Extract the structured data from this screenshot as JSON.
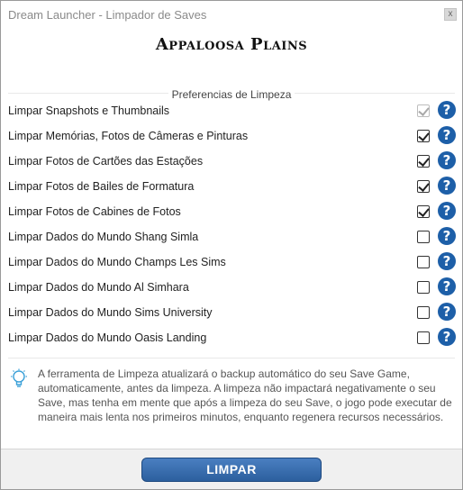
{
  "window": {
    "title": "Dream Launcher - Limpador de Saves",
    "close_glyph": "x"
  },
  "heading": "Appaloosa Plains",
  "section_label": "Preferencias de Limpeza",
  "options": [
    {
      "label": "Limpar Snapshots e Thumbnails",
      "checked": true,
      "disabled": true
    },
    {
      "label": "Limpar Memórias, Fotos de Câmeras e Pinturas",
      "checked": true,
      "disabled": false
    },
    {
      "label": "Limpar Fotos de Cartões das Estações",
      "checked": true,
      "disabled": false
    },
    {
      "label": "Limpar Fotos de Bailes de Formatura",
      "checked": true,
      "disabled": false
    },
    {
      "label": "Limpar Fotos de Cabines de Fotos",
      "checked": true,
      "disabled": false
    },
    {
      "label": "Limpar Dados do Mundo Shang Simla",
      "checked": false,
      "disabled": false
    },
    {
      "label": "Limpar Dados do Mundo Champs Les Sims",
      "checked": false,
      "disabled": false
    },
    {
      "label": "Limpar Dados do Mundo Al Simhara",
      "checked": false,
      "disabled": false
    },
    {
      "label": "Limpar Dados do Mundo Sims University",
      "checked": false,
      "disabled": false
    },
    {
      "label": "Limpar Dados do Mundo Oasis Landing",
      "checked": false,
      "disabled": false
    }
  ],
  "help_glyph": "?",
  "info": {
    "icon": "lightbulb-icon",
    "text": "A ferramenta de Limpeza atualizará o backup automático do seu Save Game, automaticamente, antes da limpeza. A limpeza não impactará negativamente o seu Save, mas tenha em mente que após a limpeza do seu Save, o jogo pode executar de maneira mais lenta nos primeiros minutos, enquanto regenera recursos necessários."
  },
  "action": {
    "label": "LIMPAR"
  },
  "colors": {
    "accent": "#1d5fa8",
    "button": "#2c5f9e"
  }
}
